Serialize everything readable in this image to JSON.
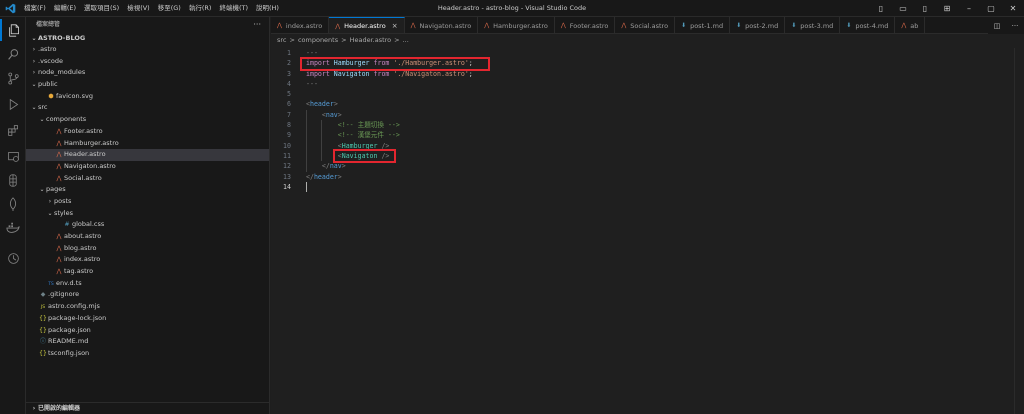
{
  "window": {
    "title": "Header.astro - astro-blog - Visual Studio Code"
  },
  "menu": [
    "檔案(F)",
    "編輯(E)",
    "選取項目(S)",
    "檢視(V)",
    "移至(G)",
    "執行(R)",
    "終端機(T)",
    "說明(H)"
  ],
  "sidebar": {
    "header": "檔案總管",
    "root": "ASTRO-BLOG",
    "footer": "已開啟的編輯器",
    "tree": [
      {
        "label": ".astro",
        "chev": "›",
        "icon": "",
        "depth": 0
      },
      {
        "label": ".vscode",
        "chev": "›",
        "icon": "",
        "depth": 0
      },
      {
        "label": "node_modules",
        "chev": "›",
        "icon": "",
        "depth": 0
      },
      {
        "label": "public",
        "chev": "⌄",
        "icon": "",
        "depth": 0
      },
      {
        "label": "favicon.svg",
        "chev": "",
        "icon": "⬢",
        "depth": 1
      },
      {
        "label": "src",
        "chev": "⌄",
        "icon": "",
        "depth": 0
      },
      {
        "label": "components",
        "chev": "⌄",
        "icon": "",
        "depth": 1
      },
      {
        "label": "Footer.astro",
        "chev": "",
        "icon": "⋀",
        "depth": 2
      },
      {
        "label": "Hamburger.astro",
        "chev": "",
        "icon": "⋀",
        "depth": 2
      },
      {
        "label": "Header.astro",
        "chev": "",
        "icon": "⋀",
        "depth": 2,
        "selected": true
      },
      {
        "label": "Navigaton.astro",
        "chev": "",
        "icon": "⋀",
        "depth": 2
      },
      {
        "label": "Social.astro",
        "chev": "",
        "icon": "⋀",
        "depth": 2
      },
      {
        "label": "pages",
        "chev": "⌄",
        "icon": "",
        "depth": 1
      },
      {
        "label": "posts",
        "chev": "›",
        "icon": "",
        "depth": 2
      },
      {
        "label": "styles",
        "chev": "⌄",
        "icon": "",
        "depth": 2
      },
      {
        "label": "global.css",
        "chev": "",
        "icon": "#",
        "depth": 3
      },
      {
        "label": "about.astro",
        "chev": "",
        "icon": "⋀",
        "depth": 2
      },
      {
        "label": "blog.astro",
        "chev": "",
        "icon": "⋀",
        "depth": 2
      },
      {
        "label": "index.astro",
        "chev": "",
        "icon": "⋀",
        "depth": 2
      },
      {
        "label": "tag.astro",
        "chev": "",
        "icon": "⋀",
        "depth": 2
      },
      {
        "label": "env.d.ts",
        "chev": "",
        "icon": "TS",
        "depth": 1
      },
      {
        "label": ".gitignore",
        "chev": "",
        "icon": "◆",
        "depth": 0
      },
      {
        "label": "astro.config.mjs",
        "chev": "",
        "icon": "JS",
        "depth": 0
      },
      {
        "label": "package-lock.json",
        "chev": "",
        "icon": "{}",
        "depth": 0
      },
      {
        "label": "package.json",
        "chev": "",
        "icon": "{}",
        "depth": 0
      },
      {
        "label": "README.md",
        "chev": "",
        "icon": "ⓘ",
        "depth": 0
      },
      {
        "label": "tsconfig.json",
        "chev": "",
        "icon": "{}",
        "depth": 0
      }
    ]
  },
  "tabs": [
    {
      "label": "index.astro",
      "icon": "⋀",
      "active": false
    },
    {
      "label": "Header.astro",
      "icon": "⋀",
      "active": true
    },
    {
      "label": "Navigaton.astro",
      "icon": "⋀",
      "active": false
    },
    {
      "label": "Hamburger.astro",
      "icon": "⋀",
      "active": false
    },
    {
      "label": "Footer.astro",
      "icon": "⋀",
      "active": false
    },
    {
      "label": "Social.astro",
      "icon": "⋀",
      "active": false
    },
    {
      "label": "post-1.md",
      "icon": "⬇",
      "active": false
    },
    {
      "label": "post-2.md",
      "icon": "⬇",
      "active": false
    },
    {
      "label": "post-3.md",
      "icon": "⬇",
      "active": false
    },
    {
      "label": "post-4.md",
      "icon": "⬇",
      "active": false
    },
    {
      "label": "ab",
      "icon": "⋀",
      "active": false
    }
  ],
  "breadcrumb": [
    "src",
    ">",
    "components",
    ">",
    "Header.astro",
    ">",
    "..."
  ],
  "code": {
    "current_line": 14,
    "lines": [
      [
        {
          "t": "---",
          "c": "t-punc"
        }
      ],
      [
        {
          "t": "import ",
          "c": "t-kw"
        },
        {
          "t": "Hamburger",
          "c": "t-id"
        },
        {
          "t": " from ",
          "c": "t-kw"
        },
        {
          "t": "'./Hamburger.astro'",
          "c": "t-str"
        },
        {
          "t": ";",
          "c": "t-plain"
        }
      ],
      [
        {
          "t": "import ",
          "c": "t-kw"
        },
        {
          "t": "Navigaton",
          "c": "t-id"
        },
        {
          "t": " from ",
          "c": "t-kw"
        },
        {
          "t": "'./Navigaton.astro'",
          "c": "t-str"
        },
        {
          "t": ";",
          "c": "t-plain"
        }
      ],
      [
        {
          "t": "---",
          "c": "t-punc"
        }
      ],
      [],
      [
        {
          "t": "<",
          "c": "t-punc"
        },
        {
          "t": "header",
          "c": "t-tag"
        },
        {
          "t": ">",
          "c": "t-punc"
        }
      ],
      [
        {
          "t": "    <",
          "c": "t-punc"
        },
        {
          "t": "nav",
          "c": "t-tag"
        },
        {
          "t": ">",
          "c": "t-punc"
        }
      ],
      [
        {
          "t": "        <!-- 主題切換 -->",
          "c": "t-comment"
        }
      ],
      [
        {
          "t": "        <!-- 漢堡元件 -->",
          "c": "t-comment"
        }
      ],
      [
        {
          "t": "        <",
          "c": "t-punc"
        },
        {
          "t": "Hamburger",
          "c": "t-comp"
        },
        {
          "t": " />",
          "c": "t-punc"
        }
      ],
      [
        {
          "t": "        <",
          "c": "t-punc"
        },
        {
          "t": "Navigaton",
          "c": "t-comp"
        },
        {
          "t": " />",
          "c": "t-punc"
        }
      ],
      [
        {
          "t": "    </",
          "c": "t-punc"
        },
        {
          "t": "nav",
          "c": "t-tag"
        },
        {
          "t": ">",
          "c": "t-punc"
        }
      ],
      [
        {
          "t": "</",
          "c": "t-punc"
        },
        {
          "t": "header",
          "c": "t-tag"
        },
        {
          "t": ">",
          "c": "t-punc"
        }
      ],
      []
    ]
  },
  "colors": {
    "accent": "#0078d4",
    "highlight_box": "#e3262f"
  }
}
